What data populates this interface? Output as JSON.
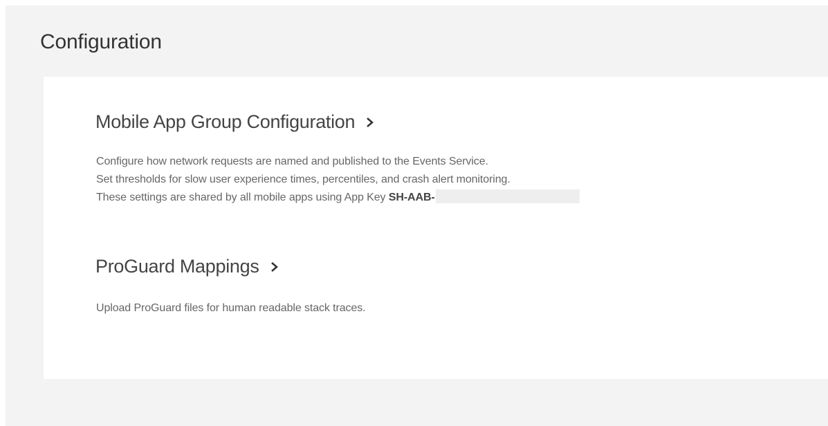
{
  "page": {
    "title": "Configuration"
  },
  "sections": [
    {
      "title": "Mobile App Group Configuration",
      "icon": "chevron-right-icon",
      "description": {
        "line1": "Configure how network requests are named and published to the Events Service.",
        "line2": "Set thresholds for slow user experience times, percentiles, and crash alert monitoring.",
        "line3_prefix": "These settings are shared by all mobile apps using App Key ",
        "app_key": "SH-AAB-"
      }
    },
    {
      "title": "ProGuard Mappings",
      "icon": "chevron-right-icon",
      "description": {
        "line1": "Upload ProGuard files for human readable stack traces."
      }
    }
  ]
}
